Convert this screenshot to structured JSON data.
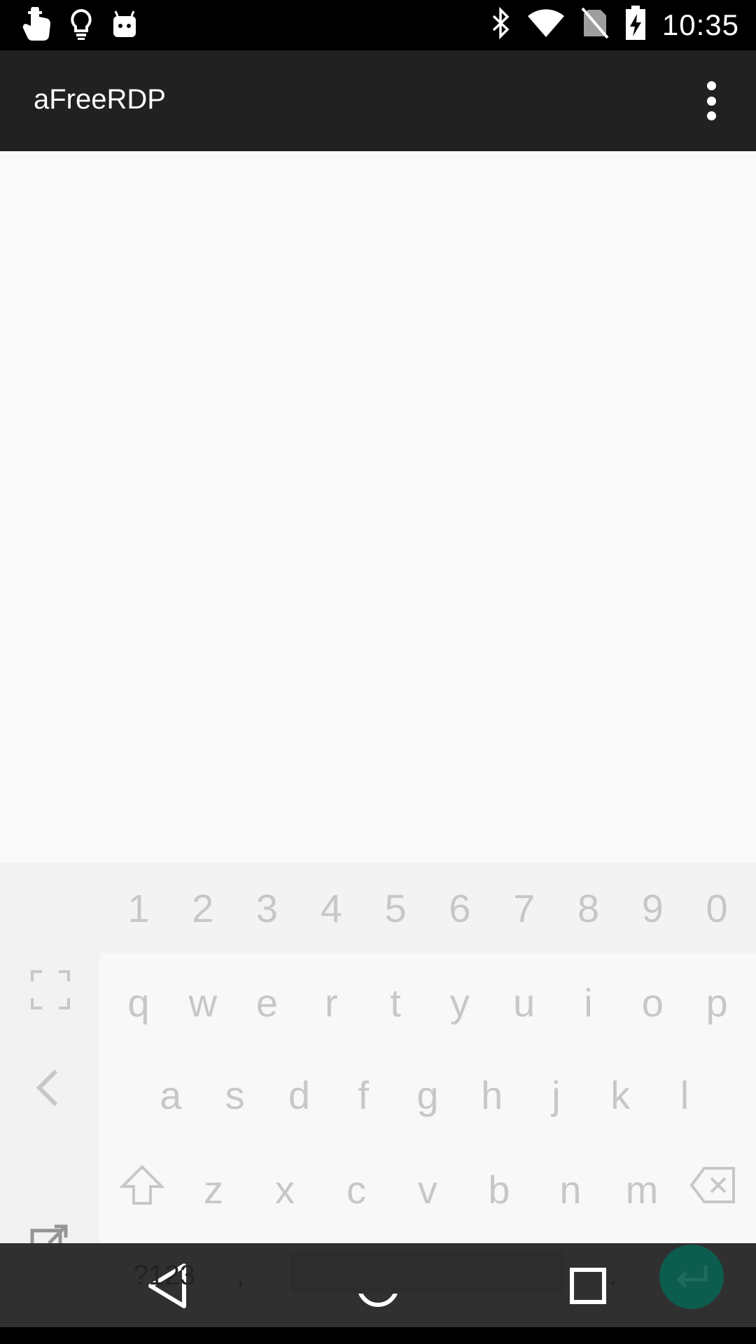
{
  "status_bar": {
    "time": "10:35",
    "left_icons": [
      "touch-icon",
      "lightbulb-icon",
      "android-icon"
    ],
    "right_icons": [
      "bluetooth-icon",
      "wifi-icon",
      "no-sim-icon",
      "battery-charging-icon"
    ]
  },
  "app_bar": {
    "title": "aFreeRDP",
    "menu_icon": "more-vert-icon"
  },
  "keyboard": {
    "number_row": [
      "1",
      "2",
      "3",
      "4",
      "5",
      "6",
      "7",
      "8",
      "9",
      "0"
    ],
    "row1": [
      "q",
      "w",
      "e",
      "r",
      "t",
      "y",
      "u",
      "i",
      "o",
      "p"
    ],
    "row2": [
      "a",
      "s",
      "d",
      "f",
      "g",
      "h",
      "j",
      "k",
      "l"
    ],
    "row3": [
      "z",
      "x",
      "c",
      "v",
      "b",
      "n",
      "m"
    ],
    "symbols_label": "?123",
    "comma_label": ",",
    "period_label": "."
  },
  "nav_bar": {
    "back": "back-icon",
    "home": "home-icon",
    "recents": "recents-icon"
  },
  "colors": {
    "status_bg": "#000000",
    "app_bar_bg": "#212121",
    "content_bg": "#fafafa",
    "nav_bg": "#303030",
    "accent": "#0d5d4f"
  }
}
